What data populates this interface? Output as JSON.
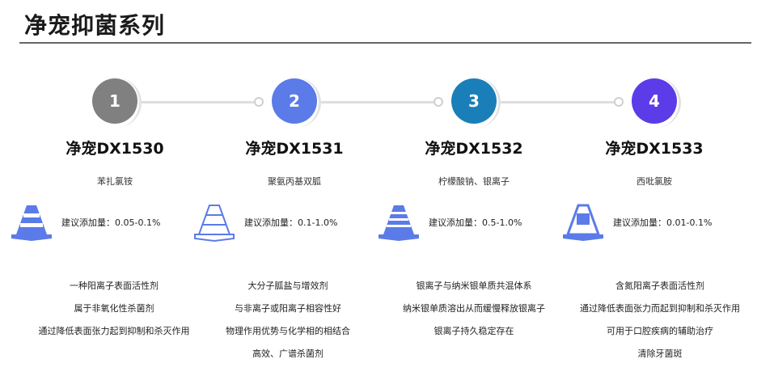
{
  "page": {
    "title": "净宠抑菌系列"
  },
  "steps": [
    {
      "number": "1",
      "color": "#808080"
    },
    {
      "number": "2",
      "color": "#5b7be8"
    },
    {
      "number": "3",
      "color": "#1a7fb8"
    },
    {
      "number": "4",
      "color": "#5b3ce8"
    }
  ],
  "products": [
    {
      "name": "净宠DX1530",
      "ingredient": "苯扎氯铵",
      "dose": "建议添加量：0.05-0.1%",
      "features": [
        "一种阳离子表面活性剂",
        "属于非氧化性杀菌剂",
        "通过降低表面张力起到抑制和杀灭作用"
      ]
    },
    {
      "name": "净宠DX1531",
      "ingredient": "聚氨丙基双胍",
      "dose": "建议添加量：0.1-1.0%",
      "features": [
        "大分子胍盐与增效剂",
        "与非离子或阳离子相容性好",
        "物理作用优势与化学相的相结合",
        "高效、广谱杀菌剂"
      ]
    },
    {
      "name": "净宠DX1532",
      "ingredient": "柠檬酸钠、银离子",
      "dose": "建议添加量：0.5-1.0%",
      "features": [
        "银离子与纳米银单质共混体系",
        "纳米银单质溶出从而缓慢释放银离子",
        "银离子持久稳定存在"
      ]
    },
    {
      "name": "净宠DX1533",
      "ingredient": "西吡氯胺",
      "dose": "建议添加量：0.01-0.1%",
      "features": [
        "含氮阳离子表面活性剂",
        "通过降低表面张力而起到抑制和杀灭作用",
        "可用于口腔疾病的辅助治疗",
        "清除牙菌斑"
      ]
    }
  ],
  "icons": {
    "cone": "traffic-cone-icon",
    "cone_color": "#5b7be8"
  }
}
